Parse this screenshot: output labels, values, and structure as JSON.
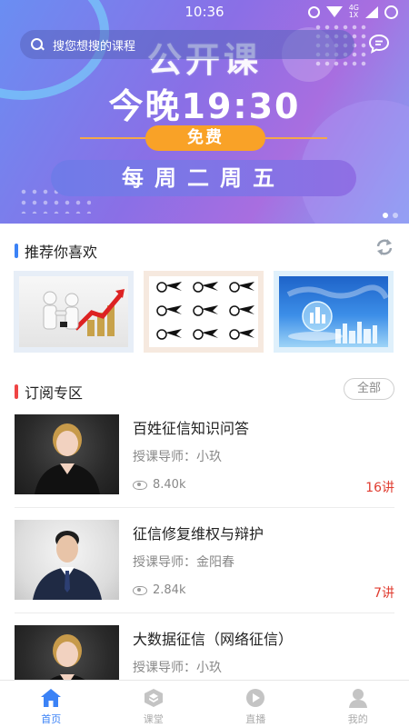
{
  "status_bar": {
    "time": "10:36",
    "network": "4G\n1X"
  },
  "search": {
    "placeholder": "搜您想搜的课程"
  },
  "banner": {
    "title": "公开课",
    "time": "今晚19:30",
    "free": "免费",
    "days": "每周二周五",
    "pages": 2,
    "current_page": 1
  },
  "recommend": {
    "title": "推荐你喜欢",
    "tiles": [
      {
        "image": "business-handshake-growth-chart"
      },
      {
        "image": "flaming-basketballs"
      },
      {
        "image": "globe-city-skyline"
      }
    ]
  },
  "subscription": {
    "title": "订阅专区",
    "all_label": "全部",
    "courses": [
      {
        "title": "百姓征信知识问答",
        "teacher": "授课导师：小玖",
        "views": "8.40k",
        "lessons": "16讲"
      },
      {
        "title": "征信修复维权与辩护",
        "teacher": "授课导师：金阳春",
        "views": "2.84k",
        "lessons": "7讲"
      },
      {
        "title": "大数据征信（网络征信）",
        "teacher": "授课导师：小玖",
        "views": "",
        "lessons": ""
      }
    ]
  },
  "tabbar": {
    "active": "首页",
    "tabs": [
      {
        "label": "首页",
        "icon": "home-icon"
      },
      {
        "label": "课堂",
        "icon": "classroom-icon"
      },
      {
        "label": "直播",
        "icon": "live-play-icon"
      },
      {
        "label": "我的",
        "icon": "profile-icon"
      }
    ]
  },
  "colors": {
    "accent": "#3b82f6",
    "lesson_count": "#e03b2f",
    "free_badge": "#f9a227"
  }
}
